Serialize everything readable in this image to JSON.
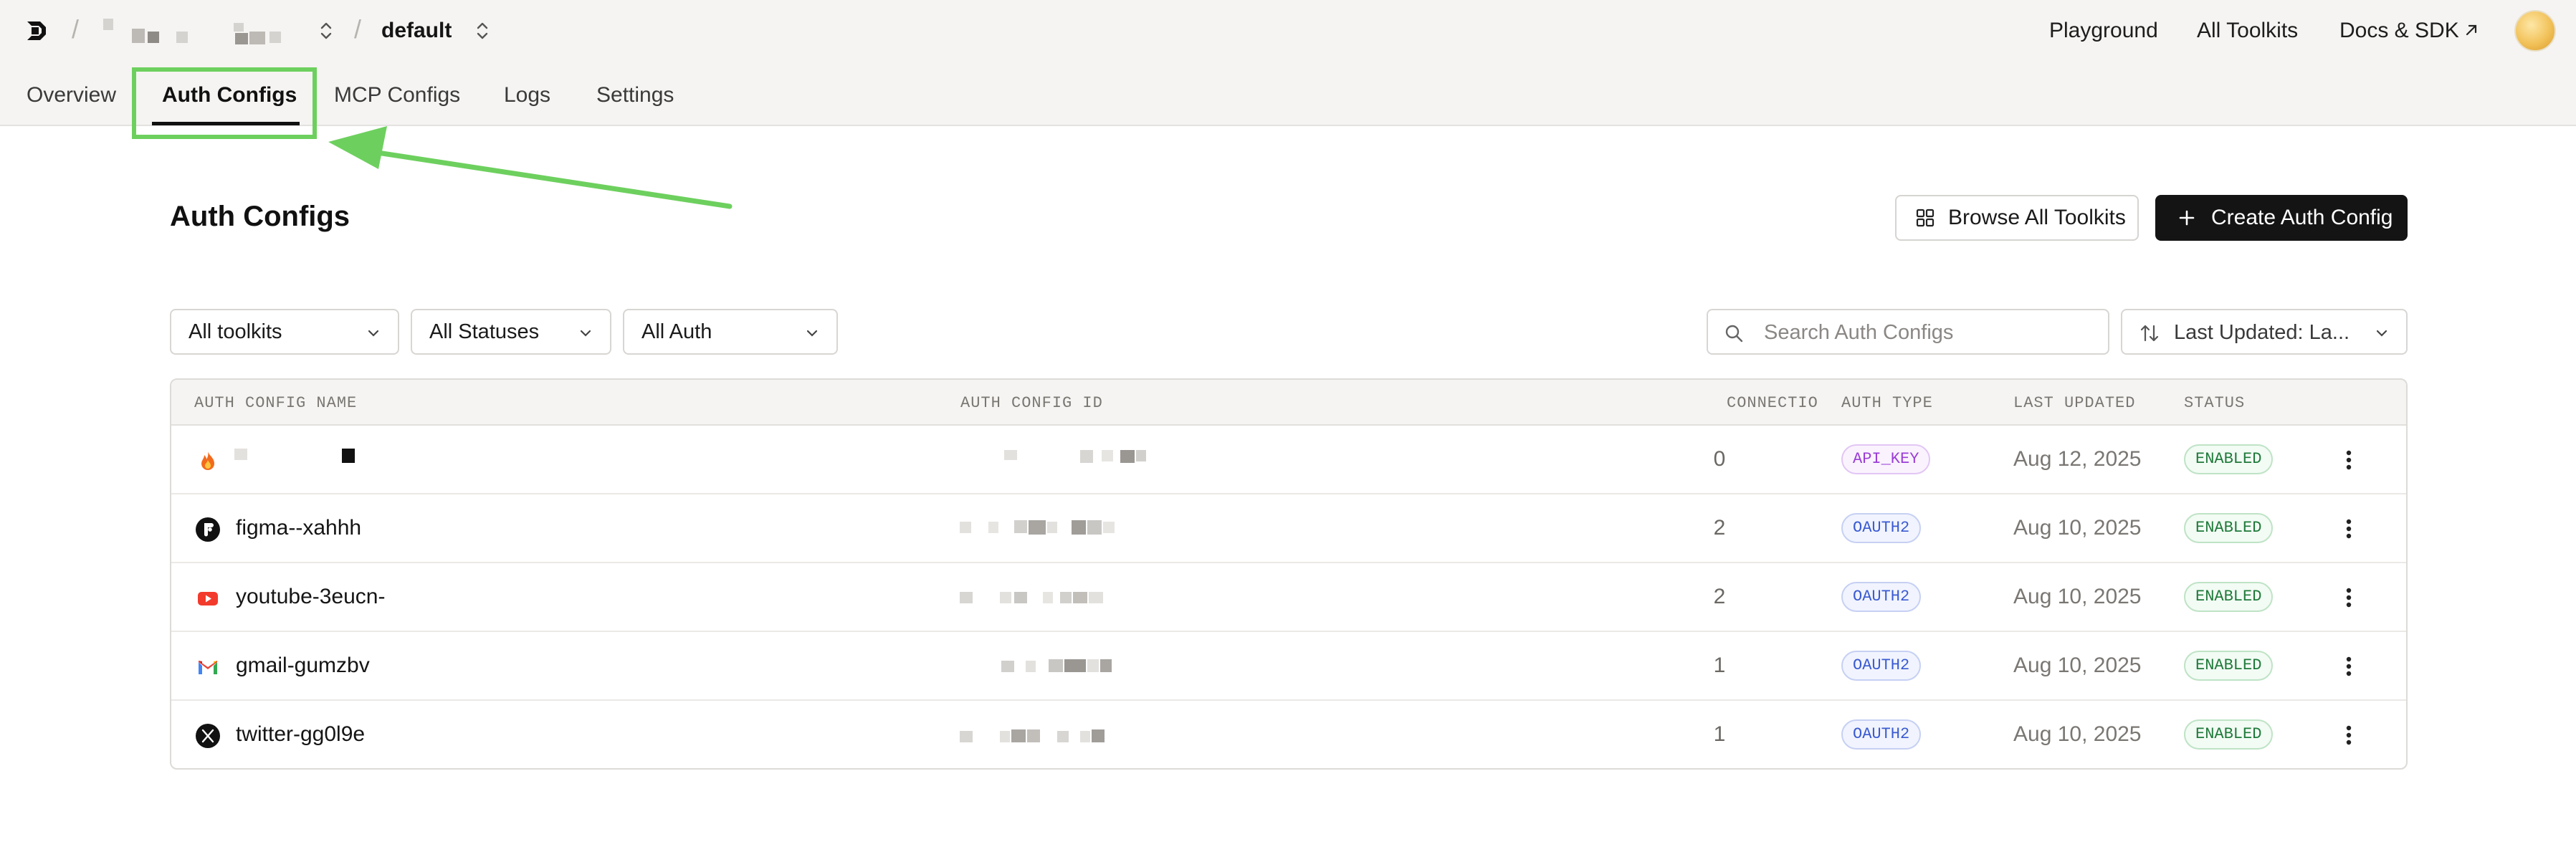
{
  "header": {
    "separator": "/",
    "project": "default",
    "links": {
      "playground": "Playground",
      "all_toolkits": "All Toolkits",
      "docs": "Docs & SDK"
    }
  },
  "tabs": [
    {
      "label": "Overview",
      "active": false
    },
    {
      "label": "Auth Configs",
      "active": true
    },
    {
      "label": "MCP Configs",
      "active": false
    },
    {
      "label": "Logs",
      "active": false
    },
    {
      "label": "Settings",
      "active": false
    }
  ],
  "page": {
    "title": "Auth Configs",
    "browse_button": "Browse All Toolkits",
    "create_button": "Create Auth Config"
  },
  "filters": {
    "toolkits": "All toolkits",
    "statuses": "All Statuses",
    "auth": "All Auth",
    "search_placeholder": "Search Auth Configs",
    "sort": "Last Updated: La..."
  },
  "table": {
    "columns": {
      "name": "AUTH CONFIG NAME",
      "id": "AUTH CONFIG ID",
      "connections": "CONNECTIO",
      "auth_type": "AUTH TYPE",
      "last_updated": "LAST UPDATED",
      "status": "STATUS"
    },
    "rows": [
      {
        "name": "",
        "icon": "fire-icon",
        "connections": "0",
        "auth_type": "API_KEY",
        "last_updated": "Aug 12, 2025",
        "status": "ENABLED"
      },
      {
        "name": "figma--xahhh",
        "icon": "figma-icon",
        "connections": "2",
        "auth_type": "OAUTH2",
        "last_updated": "Aug 10, 2025",
        "status": "ENABLED"
      },
      {
        "name": "youtube-3eucn-",
        "icon": "youtube-icon",
        "connections": "2",
        "auth_type": "OAUTH2",
        "last_updated": "Aug 10, 2025",
        "status": "ENABLED"
      },
      {
        "name": "gmail-gumzbv",
        "icon": "gmail-icon",
        "connections": "1",
        "auth_type": "OAUTH2",
        "last_updated": "Aug 10, 2025",
        "status": "ENABLED"
      },
      {
        "name": "twitter-gg0l9e",
        "icon": "x-twitter-icon",
        "connections": "1",
        "auth_type": "OAUTH2",
        "last_updated": "Aug 10, 2025",
        "status": "ENABLED"
      }
    ]
  },
  "colors": {
    "highlight": "#6dd05e",
    "primary_button": "#141414",
    "api_key_badge": "#9b3ed6",
    "oauth2_badge": "#3b5bd1",
    "enabled_badge": "#1f7a3a"
  }
}
